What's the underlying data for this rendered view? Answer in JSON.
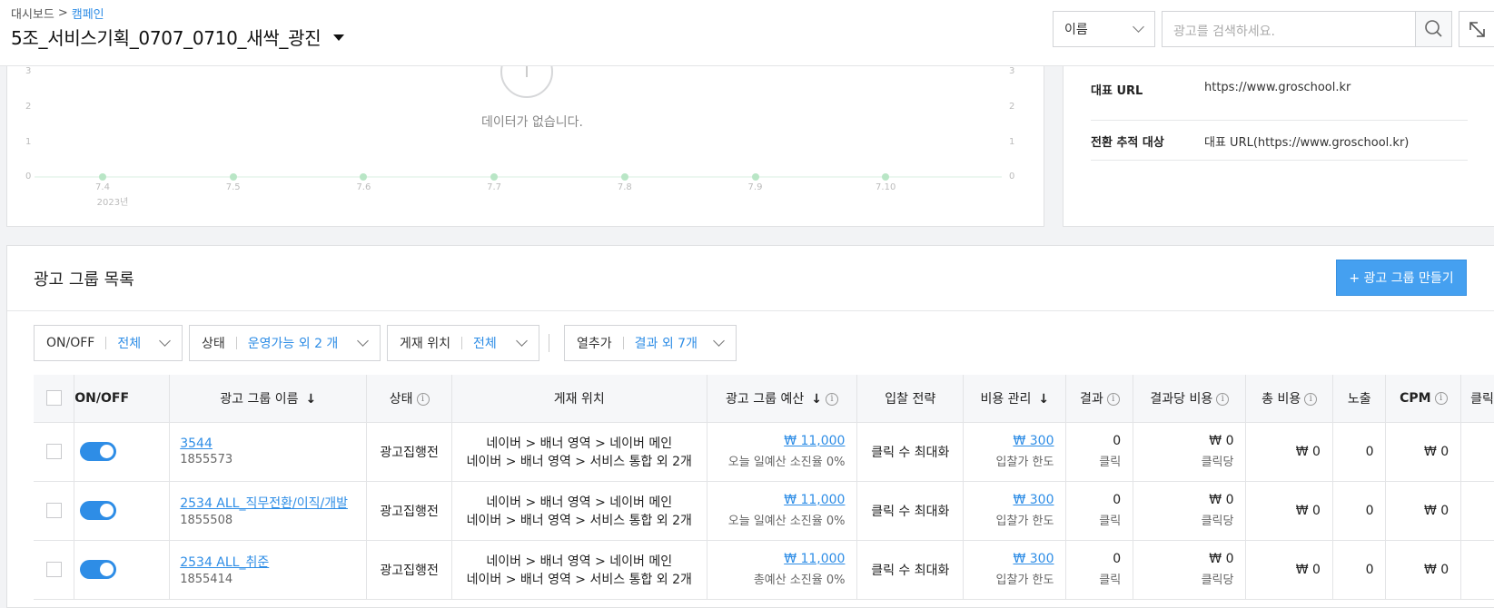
{
  "breadcrumb": {
    "root": "대시보드",
    "sep": ">",
    "current": "캠페인"
  },
  "page_title": "5조_서비스기획_0707_0710_새싹_광진",
  "search": {
    "select_value": "이름",
    "placeholder": "광고를 검색하세요."
  },
  "chart": {
    "empty_message": "데이터가 없습니다.",
    "y_ticks": [
      "3",
      "2",
      "1",
      "0"
    ],
    "x_ticks": [
      "7.4",
      "7.5",
      "7.6",
      "7.7",
      "7.8",
      "7.9",
      "7.10"
    ],
    "year_label": "2023년"
  },
  "chart_data": {
    "type": "line",
    "x": [
      "7.4",
      "7.5",
      "7.6",
      "7.7",
      "7.8",
      "7.9",
      "7.10"
    ],
    "values": [
      0,
      0,
      0,
      0,
      0,
      0,
      0
    ],
    "ylim": [
      0,
      3
    ],
    "grid": false
  },
  "info": [
    {
      "key": "대표 URL",
      "value": "https://www.groschool.kr"
    },
    {
      "key": "전환 추적 대상",
      "value": "대표 URL(https://www.groschool.kr)"
    }
  ],
  "section": {
    "title": "광고 그룹 목록",
    "create_button": "+ 광고 그룹 만들기"
  },
  "filters": [
    {
      "label": "ON/OFF",
      "value": "전체"
    },
    {
      "label": "상태",
      "value": "운영가능 외 2 개"
    },
    {
      "label": "게재 위치",
      "value": "전체"
    },
    {
      "label": "열추가",
      "value": "결과 외 7개"
    }
  ],
  "columns": {
    "onoff": "ON/OFF",
    "name": "광고 그룹 이름",
    "status": "상태",
    "placement": "게재 위치",
    "budget": "광고 그룹 예산",
    "bid": "입찰 전략",
    "cost_mgmt": "비용 관리",
    "result": "결과",
    "cpr": "결과당 비용",
    "total": "총 비용",
    "impr": "노출",
    "cpm": "CPM",
    "click": "클릭"
  },
  "rows": [
    {
      "name": "3544",
      "id": "1855573",
      "status": "광고집행전",
      "place1": "네이버 > 배너 영역 > 네이버 메인",
      "place2": "네이버 > 배너 영역 > 서비스 통합 외 2개",
      "budget": "₩ 11,000",
      "budget_sub": "오늘 일예산 소진율 0%",
      "bid": "클릭 수 최대화",
      "cost": "₩ 300",
      "cost_sub": "입찰가 한도",
      "result": "0",
      "result_sub": "클릭",
      "cpr": "₩ 0",
      "cpr_sub": "클릭당",
      "total": "₩ 0",
      "impr": "0",
      "cpm": "₩ 0"
    },
    {
      "name": "2534 ALL_직무전환/이직/개발",
      "id": "1855508",
      "status": "광고집행전",
      "place1": "네이버 > 배너 영역 > 네이버 메인",
      "place2": "네이버 > 배너 영역 > 서비스 통합 외 2개",
      "budget": "₩ 11,000",
      "budget_sub": "오늘 일예산 소진율 0%",
      "bid": "클릭 수 최대화",
      "cost": "₩ 300",
      "cost_sub": "입찰가 한도",
      "result": "0",
      "result_sub": "클릭",
      "cpr": "₩ 0",
      "cpr_sub": "클릭당",
      "total": "₩ 0",
      "impr": "0",
      "cpm": "₩ 0"
    },
    {
      "name": "2534 ALL_취준",
      "id": "1855414",
      "status": "광고집행전",
      "place1": "네이버 > 배너 영역 > 네이버 메인",
      "place2": "네이버 > 배너 영역 > 서비스 통합 외 2개",
      "budget": "₩ 11,000",
      "budget_sub": "총예산 소진율 0%",
      "bid": "클릭 수 최대화",
      "cost": "₩ 300",
      "cost_sub": "입찰가 한도",
      "result": "0",
      "result_sub": "클릭",
      "cpr": "₩ 0",
      "cpr_sub": "클릭당",
      "total": "₩ 0",
      "impr": "0",
      "cpm": "₩ 0"
    }
  ]
}
